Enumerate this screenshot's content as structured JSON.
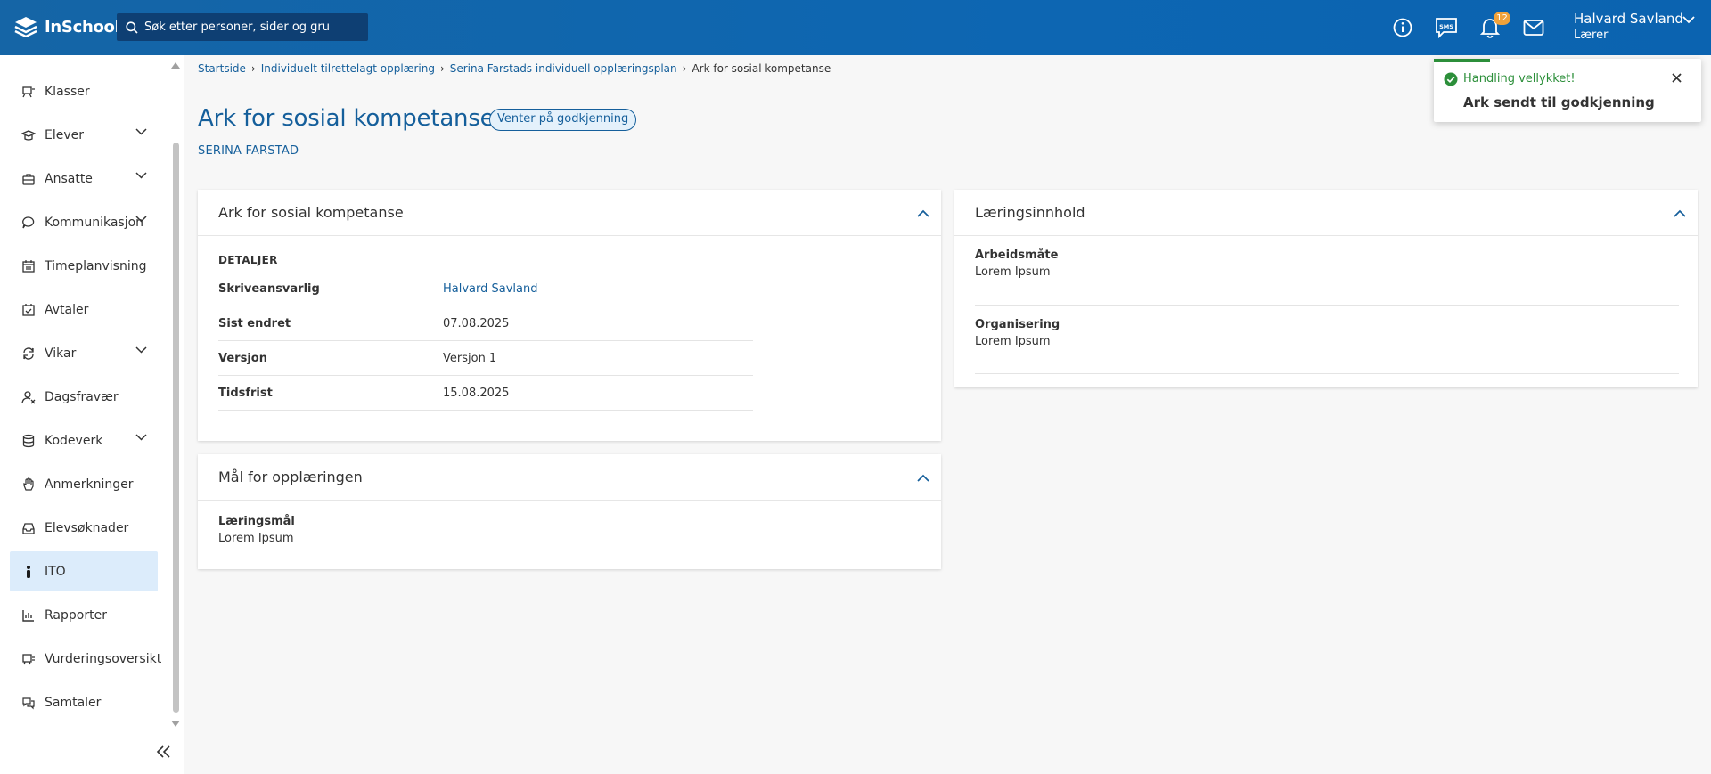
{
  "header": {
    "logo_text": "InSchool",
    "search_placeholder": "Søk etter personer, sider og gru",
    "notification_count": "12",
    "user_name": "Halvard Savland",
    "user_role": "Lærer"
  },
  "sidebar": {
    "items": [
      {
        "label": "Klasser",
        "icon": "classes-icon",
        "expandable": false,
        "active": false
      },
      {
        "label": "Elever",
        "icon": "students-icon",
        "expandable": true,
        "active": false
      },
      {
        "label": "Ansatte",
        "icon": "staff-icon",
        "expandable": true,
        "active": false
      },
      {
        "label": "Kommunikasjon",
        "icon": "chat-icon",
        "expandable": true,
        "active": false
      },
      {
        "label": "Timeplanvisning",
        "icon": "calendar-icon",
        "expandable": false,
        "active": false
      },
      {
        "label": "Avtaler",
        "icon": "calendar-check-icon",
        "expandable": false,
        "active": false
      },
      {
        "label": "Vikar",
        "icon": "swap-icon",
        "expandable": true,
        "active": false
      },
      {
        "label": "Dagsfravær",
        "icon": "user-absence-icon",
        "expandable": false,
        "active": false
      },
      {
        "label": "Kodeverk",
        "icon": "database-icon",
        "expandable": true,
        "active": false
      },
      {
        "label": "Anmerkninger",
        "icon": "hand-icon",
        "expandable": false,
        "active": false
      },
      {
        "label": "Elevsøknader",
        "icon": "inbox-icon",
        "expandable": false,
        "active": false
      },
      {
        "label": "ITO",
        "icon": "person-icon",
        "expandable": false,
        "active": true
      },
      {
        "label": "Rapporter",
        "icon": "chart-icon",
        "expandable": false,
        "active": false
      },
      {
        "label": "Vurderingsoversikt",
        "icon": "assessment-icon",
        "expandable": false,
        "active": false
      },
      {
        "label": "Samtaler",
        "icon": "conversation-icon",
        "expandable": false,
        "active": false
      }
    ]
  },
  "breadcrumb": {
    "items": [
      "Startside",
      "Individuelt tilrettelagt opplæring",
      "Serina Farstads individuell opplæringsplan"
    ],
    "current": "Ark for sosial kompetanse"
  },
  "page": {
    "title": "Ark for sosial kompetanse",
    "status": "Venter på godkjenning",
    "person": "SERINA FARSTAD"
  },
  "card_sheet": {
    "title": "Ark for sosial kompetanse",
    "section": "DETALJER",
    "rows": [
      {
        "key": "Skriveansvarlig",
        "value": "Halvard Savland"
      },
      {
        "key": "Sist endret",
        "value": "07.08.2025"
      },
      {
        "key": "Versjon",
        "value": "Versjon 1"
      },
      {
        "key": "Tidsfrist",
        "value": "15.08.2025"
      }
    ]
  },
  "card_goals": {
    "title": "Mål for opplæringen",
    "field_label": "Læringsmål",
    "field_value": "Lorem Ipsum"
  },
  "card_content": {
    "title": "Læringsinnhold",
    "fields": [
      {
        "label": "Arbeidsmåte",
        "value": "Lorem Ipsum"
      },
      {
        "label": "Organisering",
        "value": "Lorem Ipsum"
      }
    ]
  },
  "toast": {
    "title": "Handling vellykket!",
    "message": "Ark sendt til godkjenning"
  },
  "colors": {
    "header": "#0d66b2",
    "link": "#155f9b",
    "success": "#2c8f3a",
    "active_nav": "#dcecfb",
    "badge": "#f0a23b"
  }
}
